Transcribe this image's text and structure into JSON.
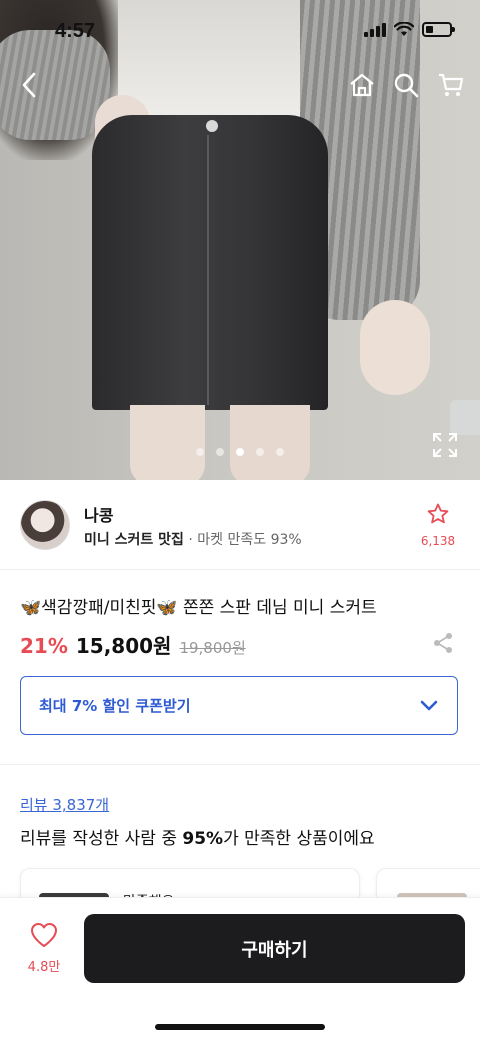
{
  "status": {
    "time": "4:57"
  },
  "gallery": {
    "total": 5,
    "active_index": 2
  },
  "seller": {
    "name": "나콩",
    "tag": "미니 스커트 맛집",
    "satisfaction": "· 마켓 만족도 93%",
    "favorite_count": "6,138"
  },
  "product": {
    "title": "🦋색감깡패/미친핏🦋 쫀쫀 스판 데님 미니 스커트",
    "discount": "21%",
    "price": "15,800원",
    "original_price": "19,800원"
  },
  "coupon": {
    "label": "최대 7% 할인 쿠폰받기"
  },
  "reviews": {
    "link": "리뷰 3,837개",
    "summary_prefix": "리뷰를 작성한 사람 중 ",
    "summary_percent": "95%",
    "summary_suffix": "가 만족한 상품이에요",
    "card_text": "만족해요"
  },
  "bottom": {
    "like_count": "4.8만",
    "buy_label": "구매하기"
  },
  "colors": {
    "accent_red": "#e74c55",
    "accent_blue": "#3a66d6",
    "buy_bg": "#1c1c1e"
  }
}
